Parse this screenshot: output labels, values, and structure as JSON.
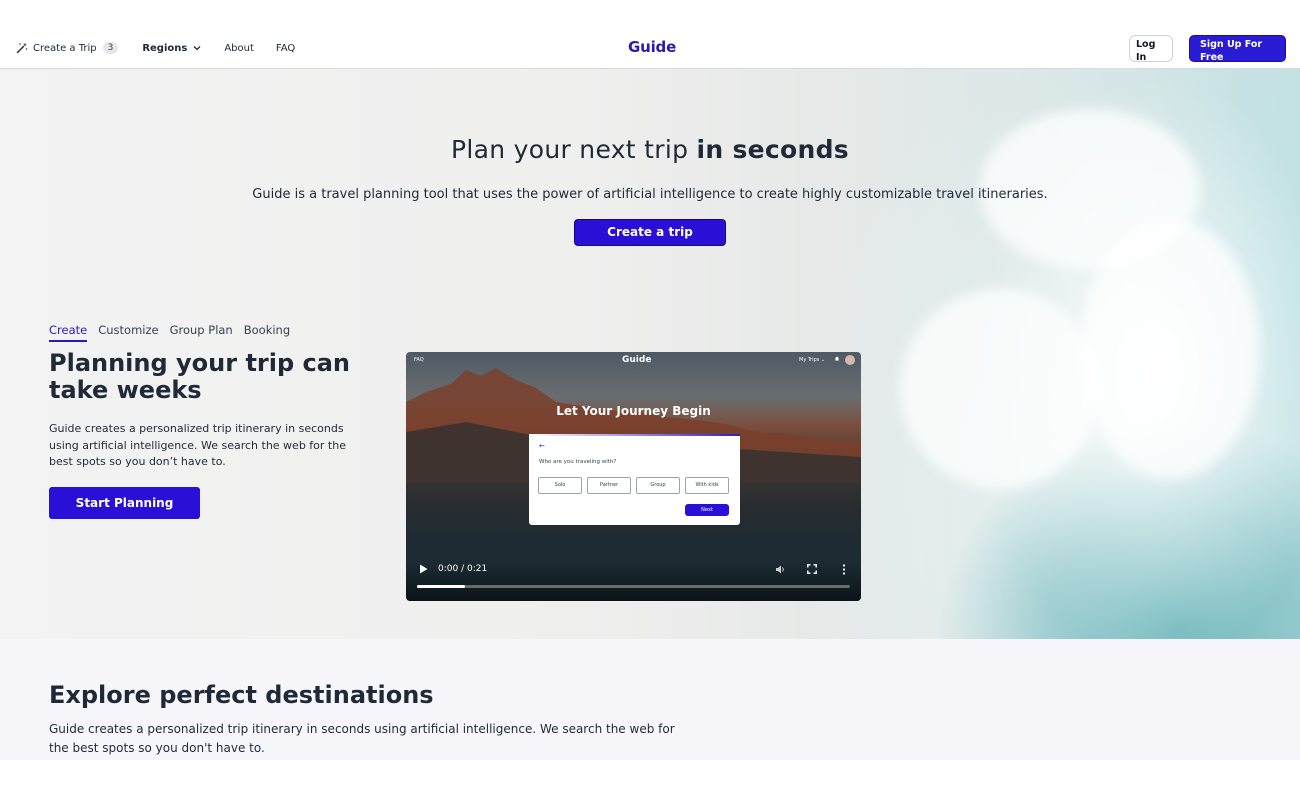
{
  "nav": {
    "create_trip_label": "Create a Trip",
    "create_trip_count": "3",
    "regions_label": "Regions",
    "about_label": "About",
    "faq_label": "FAQ",
    "logo": "Guide",
    "login_label": "Log In",
    "signup_label": "Sign Up For Free"
  },
  "hero": {
    "title_regular": "Plan your next trip",
    "title_bold": "in seconds",
    "subtitle": "Guide is a travel planning tool that uses the power of artificial intelligence to create highly customizable travel itineraries.",
    "cta_label": "Create a trip"
  },
  "feature": {
    "tabs": [
      {
        "label": "Create",
        "active": true
      },
      {
        "label": "Customize",
        "active": false
      },
      {
        "label": "Group Plan",
        "active": false
      },
      {
        "label": "Booking",
        "active": false
      }
    ],
    "title": "Planning your trip can take weeks",
    "description": "Guide creates a personalized trip itinerary in seconds using artificial intelligence. We search the web for the best spots so you don’t have to.",
    "cta_label": "Start Planning"
  },
  "video": {
    "top_faq": "FAQ",
    "top_logo": "Guide",
    "top_mytrips": "My Trips ⌄",
    "heading": "Let Your Journey Begin",
    "question": "Who are you traveling with?",
    "options": [
      "Solo",
      "Partner",
      "Group",
      "With kids"
    ],
    "next_label": "Next",
    "time": "0:00 / 0:21",
    "progress_fraction": 0.11
  },
  "explore": {
    "title": "Explore perfect destinations",
    "description": "Guide creates a personalized trip itinerary in seconds using artificial intelligence. We search the web for the best spots so you don't have to."
  },
  "colors": {
    "brand": "#2a1bd4",
    "text": "#1f2937",
    "accent_link": "#2a1bb8"
  },
  "icons": {
    "create_trip": "magic-wand-icon",
    "regions": "chevron-down-icon",
    "play": "play-icon",
    "volume": "volume-icon",
    "fullscreen": "fullscreen-icon",
    "more": "more-vertical-icon"
  }
}
